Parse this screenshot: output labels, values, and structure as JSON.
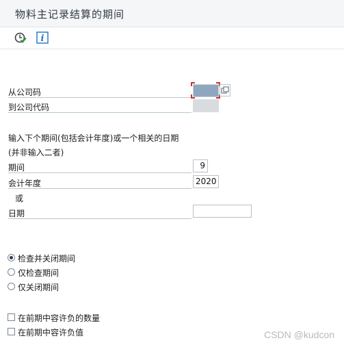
{
  "window": {
    "title": "物料主记录结算的期间"
  },
  "toolbar": {
    "execute_icon": "execute-check-icon",
    "info_icon": "info-icon"
  },
  "form": {
    "company_from_label": "从公司码",
    "company_to_label": "到公司代码",
    "instruction_line1": "输入下个期间(包括会计年度)或一个相关的日期",
    "instruction_line2": "(并非输入二者)",
    "period_label": "期间",
    "period_value": "9",
    "fiscal_year_label": "会计年度",
    "fiscal_year_value": "2020",
    "or_label": "或",
    "date_label": "日期",
    "date_value": ""
  },
  "options": {
    "radios": [
      {
        "label": "检查并关闭期间",
        "selected": true
      },
      {
        "label": "仅检查期间",
        "selected": false
      },
      {
        "label": "仅关闭期间",
        "selected": false
      }
    ],
    "checkboxes": [
      {
        "label": "在前期中容许负的数量",
        "checked": false
      },
      {
        "label": "在前期中容许负值",
        "checked": false
      }
    ]
  },
  "watermark": "CSDN @kudcon",
  "colors": {
    "accent": "#8fa6bf",
    "selection_mark": "#d0302f"
  }
}
